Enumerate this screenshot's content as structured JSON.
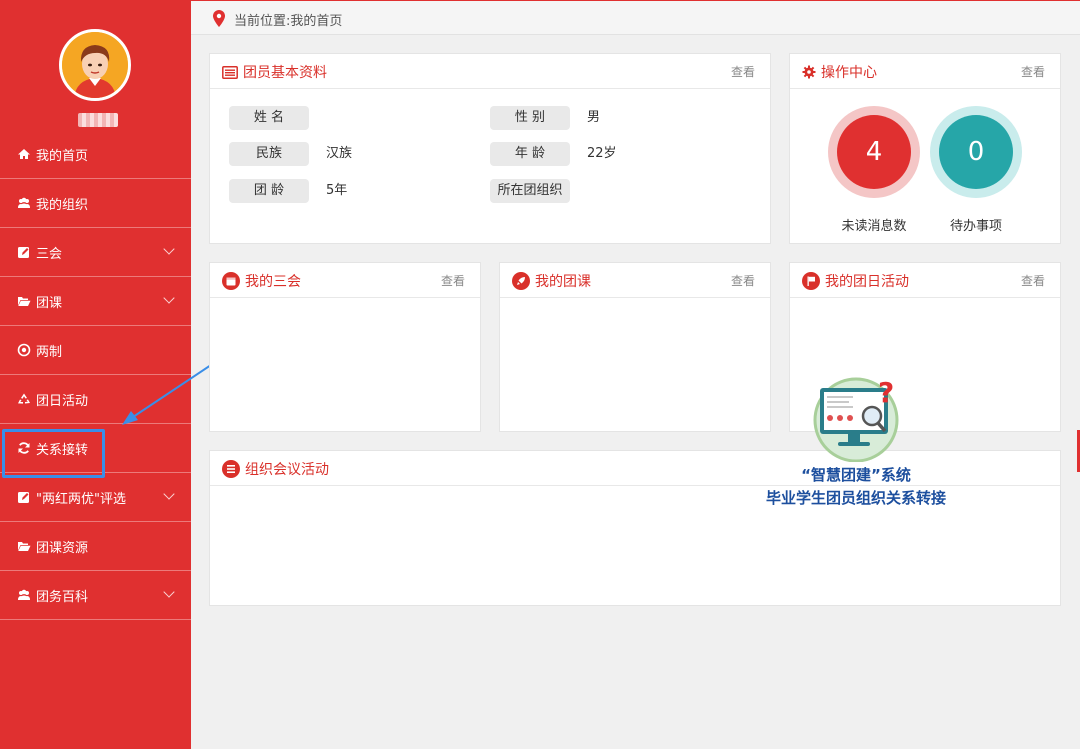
{
  "user": {
    "name": "████"
  },
  "sidebar": {
    "items": [
      {
        "label": "我的首页",
        "icon": "home-icon",
        "has_submenu": false
      },
      {
        "label": "我的组织",
        "icon": "users-icon",
        "has_submenu": false
      },
      {
        "label": "三会",
        "icon": "edit-icon",
        "has_submenu": true
      },
      {
        "label": "团课",
        "icon": "folder-open-icon",
        "has_submenu": true
      },
      {
        "label": "两制",
        "icon": "target-icon",
        "has_submenu": false
      },
      {
        "label": "团日活动",
        "icon": "recycle-icon",
        "has_submenu": false
      },
      {
        "label": "关系接转",
        "icon": "refresh-icon",
        "has_submenu": false
      },
      {
        "label": "\"两红两优\"评选",
        "icon": "edit-icon",
        "has_submenu": true
      },
      {
        "label": "团课资源",
        "icon": "folder-open-icon",
        "has_submenu": false
      },
      {
        "label": "团务百科",
        "icon": "users-icon",
        "has_submenu": true
      }
    ]
  },
  "header": {
    "location": "当前位置:我的首页"
  },
  "profile": {
    "title": "团员基本资料",
    "more": "查看",
    "fields": {
      "name_label": "姓 名",
      "name_value": "",
      "gender_label": "性 别",
      "gender_value": "男",
      "ethnicity_label": "民族",
      "ethnicity_value": "汉族",
      "age_label": "年 龄",
      "age_value": "22岁",
      "league_age_label": "团 龄",
      "league_age_value": "5年",
      "org_label": "所在团组织",
      "org_value": ""
    }
  },
  "ops": {
    "title": "操作中心",
    "more": "查看",
    "unread_count": "4",
    "unread_label": "未读消息数",
    "todo_count": "0",
    "todo_label": "待办事项"
  },
  "meetings": {
    "title": "我的三会",
    "more": "查看"
  },
  "lessons": {
    "title": "我的团课",
    "more": "查看"
  },
  "activities": {
    "title": "我的团日活动",
    "more": "查看"
  },
  "org_meetings": {
    "title": "组织会议活动"
  },
  "overlay": {
    "line1": "“智慧团建”系统",
    "line2": "毕业学生团员组织关系转接"
  },
  "colors": {
    "primary": "#e03030",
    "teal": "#26a6a8",
    "highlight": "#3a8ee8"
  }
}
